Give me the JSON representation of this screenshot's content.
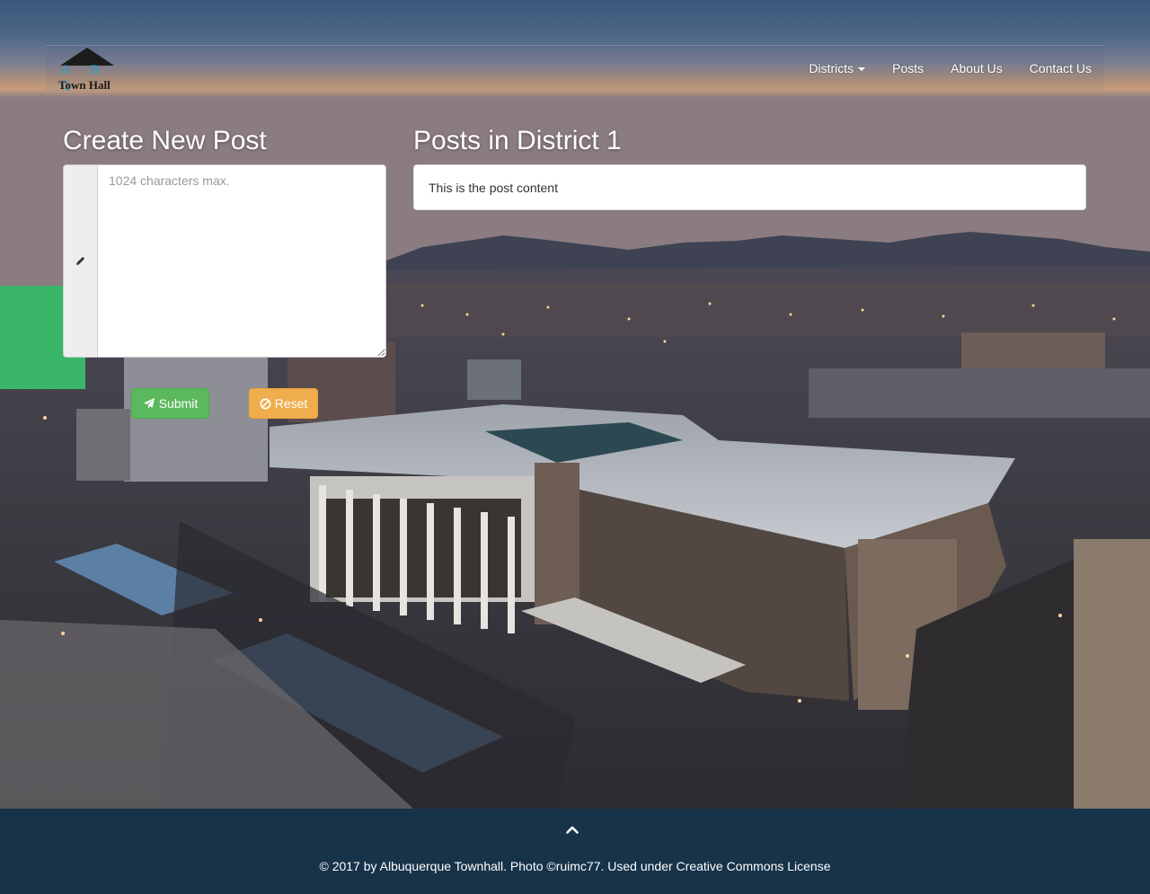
{
  "brand": {
    "letters": "A B Q",
    "subtitle": "Town Hall"
  },
  "nav": {
    "items": [
      {
        "label": "Districts",
        "dropdown": true
      },
      {
        "label": "Posts"
      },
      {
        "label": "About Us"
      },
      {
        "label": "Contact Us"
      }
    ]
  },
  "create": {
    "title": "Create New Post",
    "placeholder": "1024 characters max.",
    "submit_label": "Submit",
    "reset_label": "Reset",
    "addon_icon": "pencil-icon"
  },
  "posts": {
    "title": "Posts in District 1",
    "items": [
      {
        "content": "This is the post content"
      }
    ]
  },
  "footer": {
    "scroll_icon": "chevron-up-icon",
    "copyright": "© 2017 by Albuquerque Townhall. Photo ©ruimc77. Used under Creative Commons License"
  },
  "colors": {
    "submit": "#5cb85c",
    "reset": "#f0ad4e",
    "footer_bg": "#16334a",
    "brand_letters": "#26a0c8"
  }
}
